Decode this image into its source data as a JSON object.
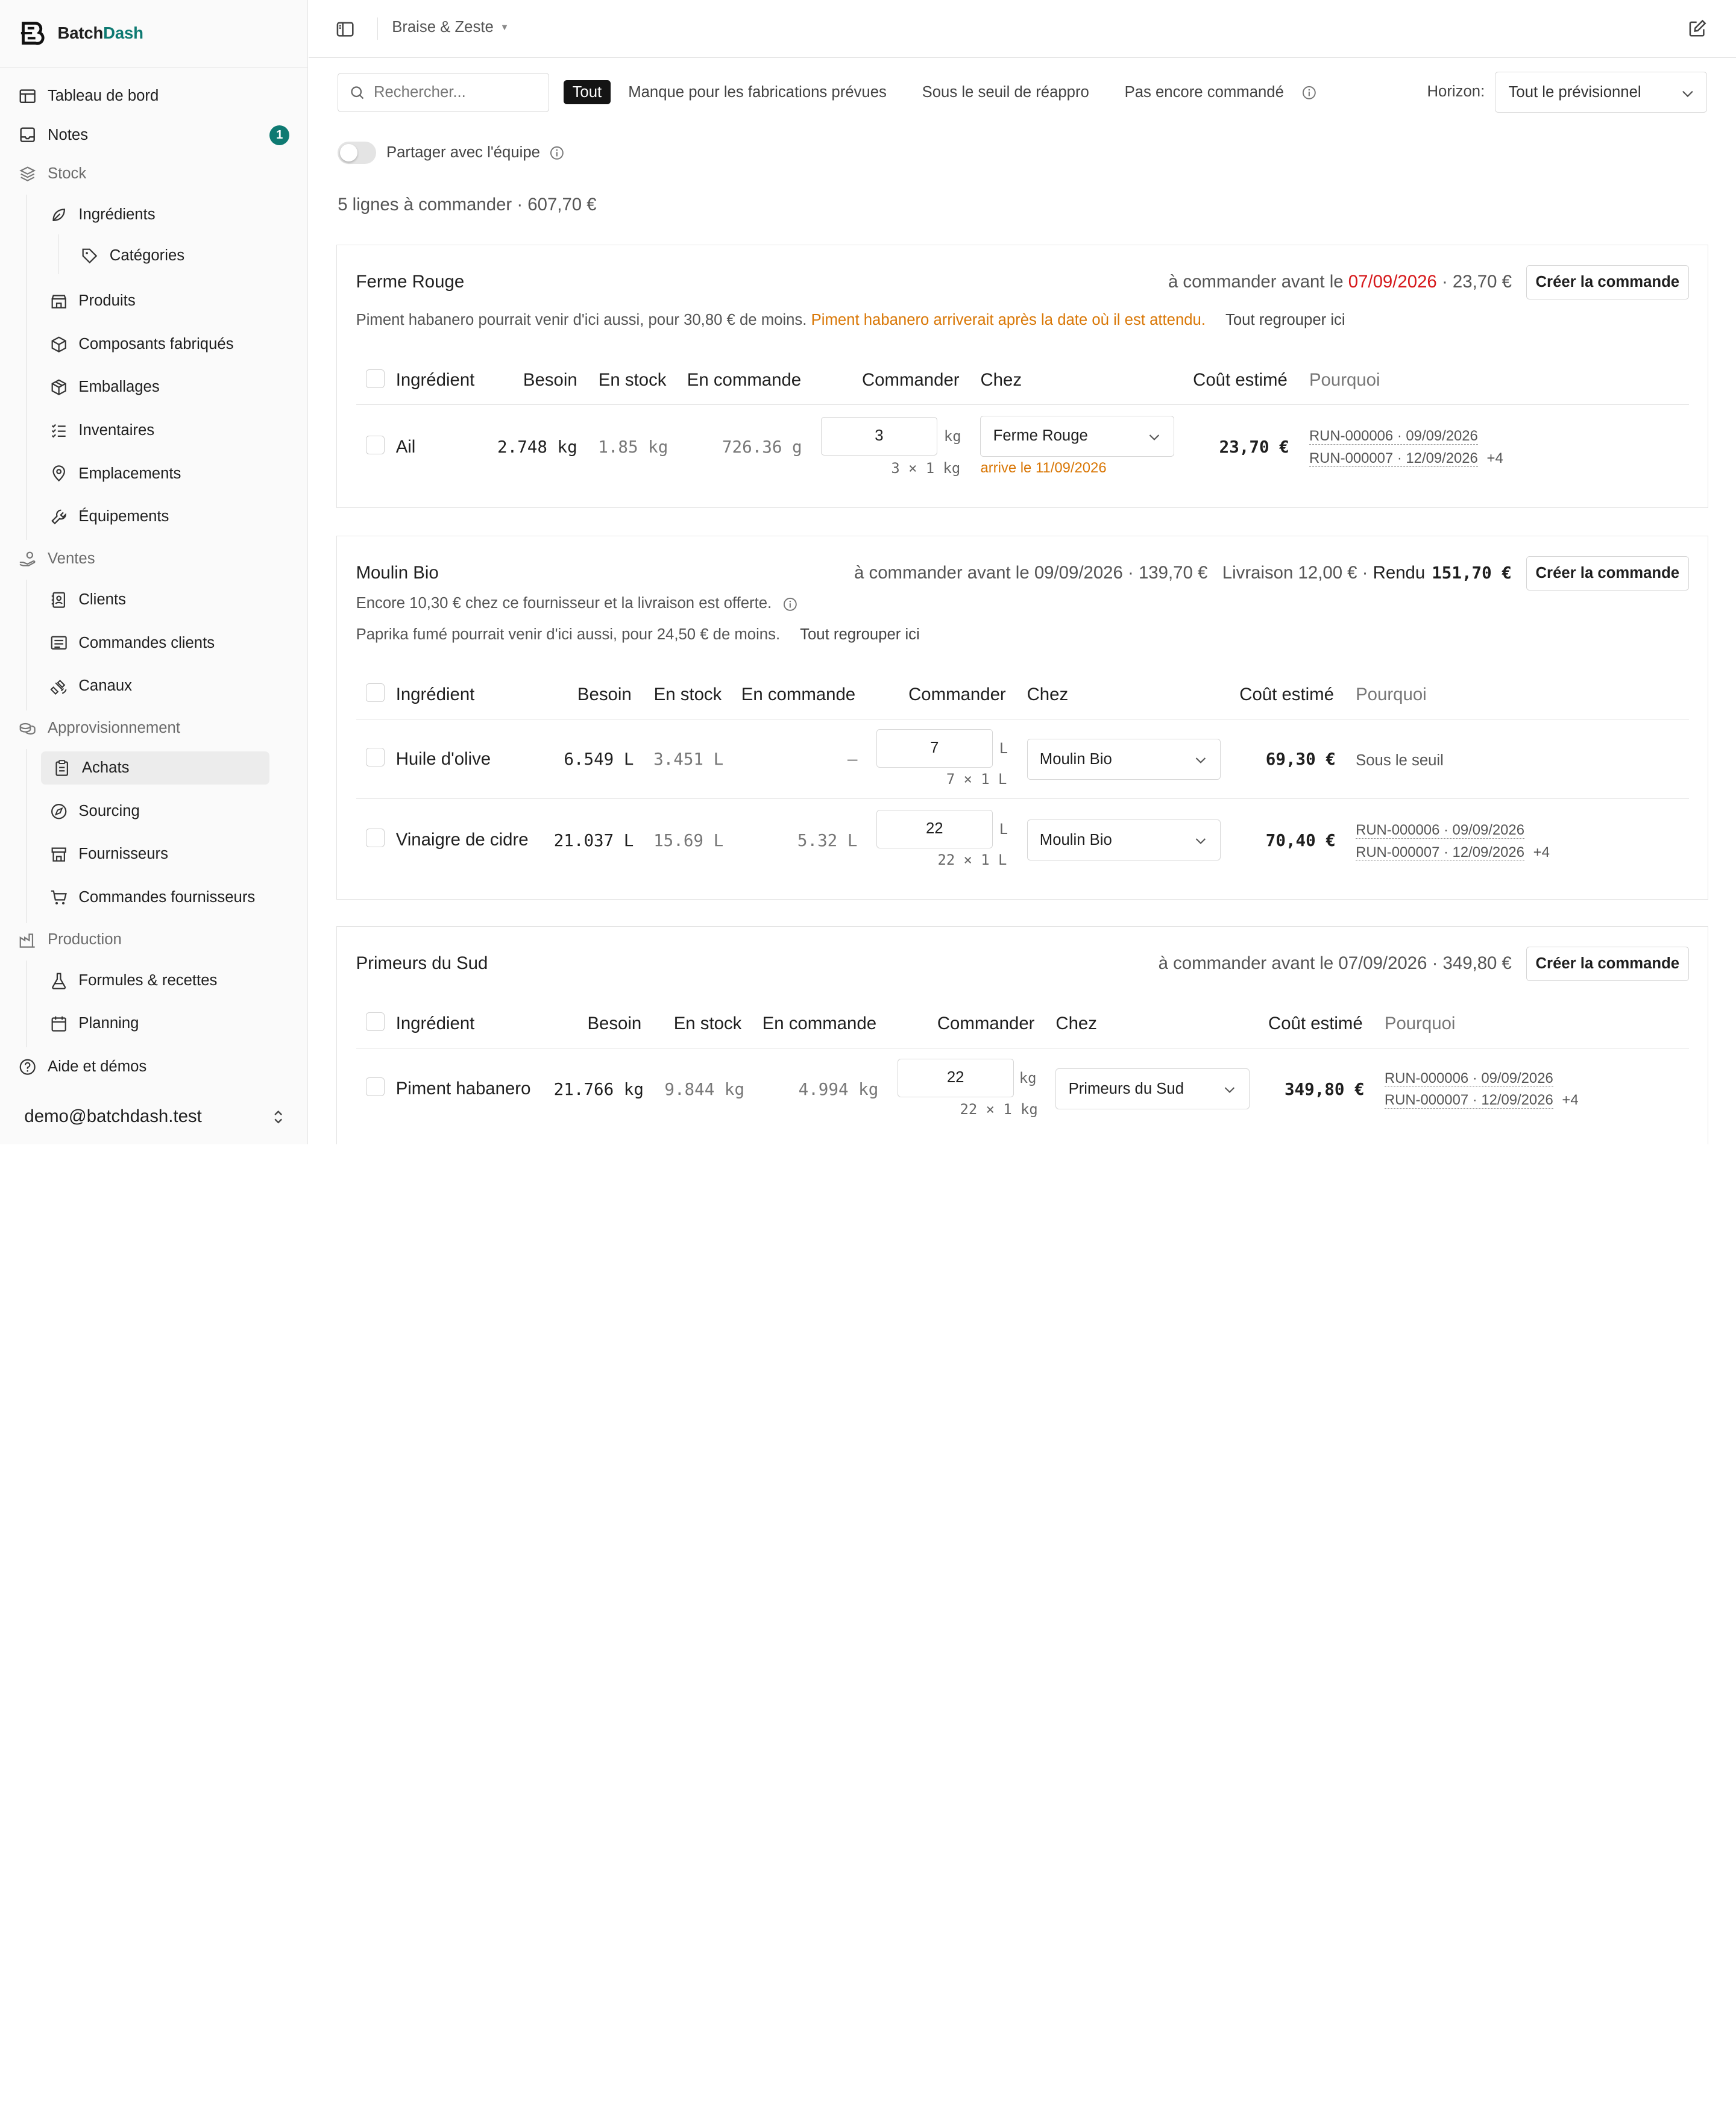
{
  "brand": {
    "prefix": "Batch",
    "accent": "Dash"
  },
  "sidebar": {
    "items": [
      {
        "label": "Tableau de bord"
      },
      {
        "label": "Notes",
        "badge": "1"
      },
      {
        "label": "Stock"
      },
      {
        "label": "Ingrédients"
      },
      {
        "label": "Catégories"
      },
      {
        "label": "Produits"
      },
      {
        "label": "Composants fabriqués"
      },
      {
        "label": "Emballages"
      },
      {
        "label": "Inventaires"
      },
      {
        "label": "Emplacements"
      },
      {
        "label": "Équipements"
      },
      {
        "label": "Ventes"
      },
      {
        "label": "Clients"
      },
      {
        "label": "Commandes clients"
      },
      {
        "label": "Canaux"
      },
      {
        "label": "Approvisionnement"
      },
      {
        "label": "Achats"
      },
      {
        "label": "Sourcing"
      },
      {
        "label": "Fournisseurs"
      },
      {
        "label": "Commandes fournisseurs"
      },
      {
        "label": "Production"
      },
      {
        "label": "Formules & recettes"
      },
      {
        "label": "Planning"
      },
      {
        "label": "Aide et démos"
      }
    ],
    "user": "demo@batchdash.test"
  },
  "header": {
    "org": "Braise & Zeste"
  },
  "toolbar": {
    "search_placeholder": "Rechercher...",
    "filters": [
      "Tout",
      "Manque pour les fabrications prévues",
      "Sous le seuil de réappro",
      "Pas encore commandé"
    ],
    "horizon_label": "Horizon:",
    "horizon_value": "Tout le prévisionnel",
    "share_label": "Partager avec l'équipe"
  },
  "summary": "5 lignes à commander · 607,70 €",
  "table_headers": {
    "ingredient": "Ingrédient",
    "need": "Besoin",
    "stock": "En stock",
    "ordered": "En commande",
    "order": "Commander",
    "from": "Chez",
    "cost": "Coût estimé",
    "why": "Pourquoi"
  },
  "create_label": "Créer la commande",
  "group_label": "Tout regrouper ici",
  "suppliers": [
    {
      "name": "Ferme Rouge",
      "deadline_prefix": "à commander avant le",
      "deadline_date": "07/09/2026",
      "total": "· 23,70 €",
      "note": "Piment habanero pourrait venir d'ici aussi, pour 30,80 € de moins.",
      "warning": "Piment habanero arriverait après la date où il est attendu.",
      "rows": [
        {
          "ingredient": "Ail",
          "need": "2.748 kg",
          "stock": "1.85 kg",
          "ordered": "726.36 g",
          "qty": "3",
          "unit": "kg",
          "pack": "3 × 1 kg",
          "from": "Ferme Rouge",
          "arrive": "arrive le 11/09/2026",
          "cost": "23,70 €",
          "why": [
            "RUN-000006 · 09/09/2026",
            "RUN-000007 · 12/09/2026"
          ],
          "more": "+4"
        }
      ]
    },
    {
      "name": "Moulin Bio",
      "deadline_text": "à commander avant le 09/09/2026 · 139,70 €",
      "delivery": "Livraison 12,00 € ·",
      "rendu_label": "Rendu",
      "rendu_value": "151,70 €",
      "note1": "Encore 10,30 € chez ce fournisseur et la livraison est offerte.",
      "note2": "Paprika fumé pourrait venir d'ici aussi, pour 24,50 € de moins.",
      "rows": [
        {
          "ingredient": "Huile d'olive",
          "need": "6.549 L",
          "stock": "3.451 L",
          "ordered": "–",
          "qty": "7",
          "unit": "L",
          "pack": "7 × 1 L",
          "from": "Moulin Bio",
          "cost": "69,30 €",
          "why_text": "Sous le seuil"
        },
        {
          "ingredient": "Vinaigre de cidre",
          "need": "21.037 L",
          "stock": "15.69 L",
          "ordered": "5.32 L",
          "qty": "22",
          "unit": "L",
          "pack": "22 × 1 L",
          "from": "Moulin Bio",
          "cost": "70,40 €",
          "why": [
            "RUN-000006 · 09/09/2026",
            "RUN-000007 · 12/09/2026"
          ],
          "more": "+4"
        }
      ]
    },
    {
      "name": "Primeurs du Sud",
      "deadline_text": "à commander avant le 07/09/2026 · 349,80 €",
      "rows": [
        {
          "ingredient": "Piment habanero",
          "need": "21.766 kg",
          "stock": "9.844 kg",
          "ordered": "4.994 kg",
          "qty": "22",
          "unit": "kg",
          "pack": "22 × 1 kg",
          "from": "Primeurs du Sud",
          "cost": "349,80 €",
          "why": [
            "RUN-000006 · 09/09/2026",
            "RUN-000007 · 12/09/2026"
          ],
          "more": "+4"
        }
      ]
    }
  ],
  "colors": {
    "accent": "#0e7a72",
    "danger": "#d6181b",
    "warning": "#d97706"
  }
}
